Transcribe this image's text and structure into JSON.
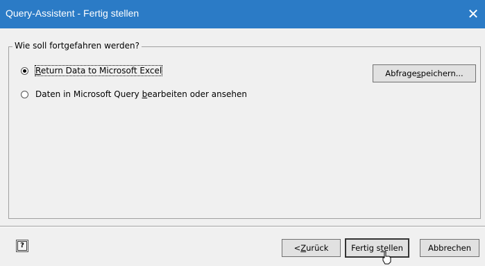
{
  "window": {
    "title": "Query-Assistent - Fertig stellen",
    "close_glyph": "✕"
  },
  "group": {
    "legend": "Wie soll fortgefahren werden?"
  },
  "options": [
    {
      "pre": "",
      "key": "R",
      "post": "eturn Data to Microsoft Excel",
      "checked": true
    },
    {
      "pre": "Daten in Microsoft Query ",
      "key": "b",
      "post": "earbeiten oder ansehen",
      "checked": false
    }
  ],
  "save_button": {
    "pre": "Abfrage ",
    "key": "s",
    "post": "peichern..."
  },
  "footer": {
    "help_glyph": "?",
    "back": {
      "pre": "< ",
      "key": "Z",
      "post": "urück"
    },
    "finish": {
      "pre": "Fertig s",
      "key": "t",
      "post": "ellen"
    },
    "cancel": {
      "label": "Abbrechen"
    }
  }
}
